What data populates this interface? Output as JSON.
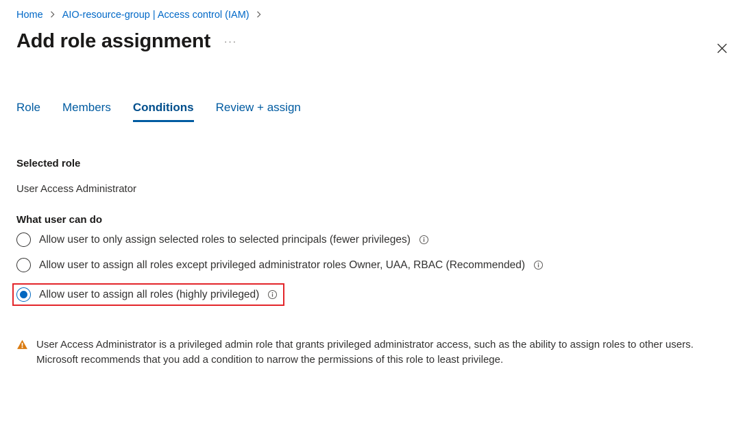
{
  "breadcrumb": {
    "home": "Home",
    "resource": "AIO-resource-group | Access control (IAM)"
  },
  "title": "Add role assignment",
  "tabs": {
    "role": "Role",
    "members": "Members",
    "conditions": "Conditions",
    "review": "Review + assign"
  },
  "selectedRoleHeading": "Selected role",
  "selectedRoleValue": "User Access Administrator",
  "whatHeading": "What user can do",
  "options": {
    "opt1": "Allow user to only assign selected roles to selected principals (fewer privileges)",
    "opt2": "Allow user to assign all roles except privileged administrator roles Owner, UAA, RBAC (Recommended)",
    "opt3": "Allow user to assign all roles (highly privileged)"
  },
  "warningText": "User Access Administrator is a privileged admin role that grants privileged administrator access, such as the ability to assign roles to other users. Microsoft recommends that you add a condition to narrow the permissions of this role to least privilege."
}
